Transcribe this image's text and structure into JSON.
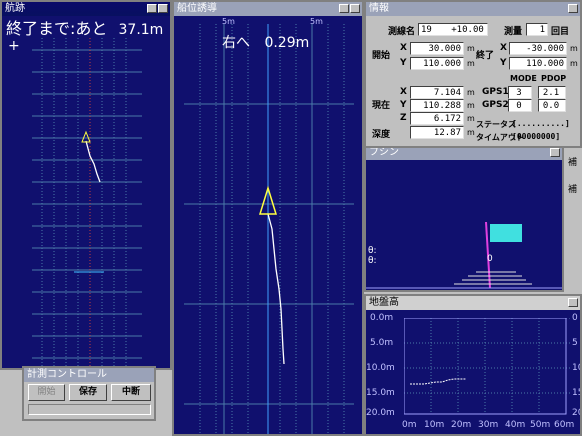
{
  "route_window": {
    "title": "航跡",
    "remaining_text": "終了まで:あと",
    "remaining_value": "37.1m"
  },
  "guidance_window": {
    "title": "船位誘導",
    "scale_left": "5m",
    "scale_right": "5m",
    "direction_text": "右へ",
    "direction_value": "0.29m"
  },
  "info_window": {
    "title": "情報",
    "line_name_label": "測線名",
    "line_name_value": "19",
    "line_offset_value": "+10.00",
    "survey_label": "測量",
    "survey_count_value": "1",
    "survey_count_unit": "回目",
    "start_label": "開始",
    "end_label": "終了",
    "start_x": "30.000",
    "start_y": "110.000",
    "end_x": "-30.000",
    "end_y": "110.000",
    "current_label": "現在",
    "current_x": "7.104",
    "current_y": "110.288",
    "current_z": "6.172",
    "depth_label": "深度",
    "depth_value": "12.87",
    "unit_m": "m",
    "x_label": "X",
    "y_label": "Y",
    "z_label": "Z",
    "mode_header": "MODE",
    "pdop_header": "PDOP",
    "gps1_label": "GPS1",
    "gps1_mode": "3",
    "gps1_pdop": "2.1",
    "gps2_label": "GPS2",
    "gps2_mode": "0",
    "gps2_pdop": "0.0",
    "status_label": "ステータス",
    "status_value": "[..........]",
    "timeout_label": "タイムアウト",
    "timeout_value": "[00000000]"
  },
  "attitude_window": {
    "title": "フシン",
    "theta_label_1": "θ:",
    "theta_label_2": "θ:",
    "zero_label": "0"
  },
  "ground_window": {
    "title": "地盤高",
    "y_ticks": [
      "0.0m",
      "5.0m",
      "10.0m",
      "15.0m",
      "20.0m"
    ],
    "y_ticks_right": [
      "0",
      "5",
      "10",
      "15",
      "20"
    ],
    "x_ticks": [
      "0m",
      "10m",
      "20m",
      "30m",
      "40m",
      "50m",
      "60m"
    ]
  },
  "control_window": {
    "title": "計測コントロール",
    "start_button": "開始",
    "save_button": "保存",
    "stop_button": "中断"
  },
  "side_labels": {
    "label_1": "補",
    "label_2": "補"
  },
  "colors": {
    "plot_bg": "#10106e",
    "grid": "#4a7aa8",
    "accent_yellow": "#ffff40",
    "track_white": "#ffffff",
    "flag_cyan": "#40e0e0",
    "flag_pole": "#e040e0",
    "center_red": "#c04040"
  }
}
